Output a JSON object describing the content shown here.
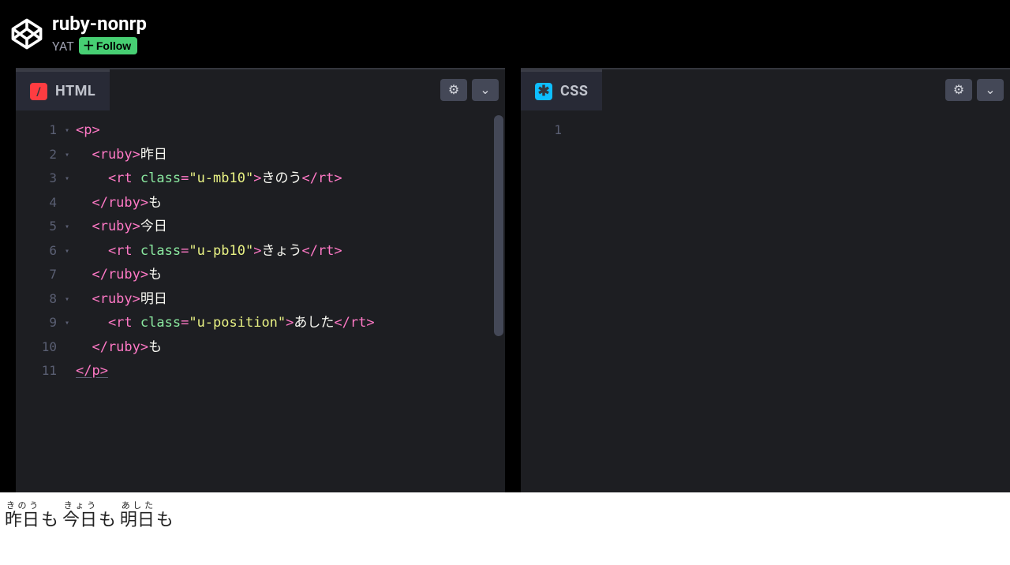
{
  "header": {
    "title": "ruby-nonrp",
    "author": "YAT",
    "follow_label": "Follow"
  },
  "editors": {
    "html": {
      "label": "HTML",
      "line_numbers": [
        "1",
        "2",
        "3",
        "4",
        "5",
        "6",
        "7",
        "8",
        "9",
        "10",
        "11"
      ],
      "fold_lines": [
        1,
        2,
        3,
        5,
        6,
        8,
        9
      ],
      "code": {
        "l1": {
          "a": "<p>"
        },
        "l2": {
          "a": "  <ruby>",
          "b": "昨日"
        },
        "l3": {
          "a": "    <rt ",
          "attr": "class",
          "eq": "=",
          "str": "\"u-mb10\"",
          "c": ">",
          "t": "きのう",
          "d": "</rt>"
        },
        "l4": {
          "a": "  </ruby>",
          "b": "も"
        },
        "l5": {
          "a": "  <ruby>",
          "b": "今日"
        },
        "l6": {
          "a": "    <rt ",
          "attr": "class",
          "eq": "=",
          "str": "\"u-pb10\"",
          "c": ">",
          "t": "きょう",
          "d": "</rt>"
        },
        "l7": {
          "a": "  </ruby>",
          "b": "も"
        },
        "l8": {
          "a": "  <ruby>",
          "b": "明日"
        },
        "l9": {
          "a": "    <rt ",
          "attr": "class",
          "eq": "=",
          "str": "\"u-position\"",
          "c": ">",
          "t": "あした",
          "d": "</rt>"
        },
        "l10": {
          "a": "  </ruby>",
          "b": "も"
        },
        "l11": {
          "a": "</p>"
        }
      }
    },
    "css": {
      "label": "CSS",
      "line_numbers": [
        "1"
      ]
    }
  },
  "preview": {
    "items": [
      {
        "base": "昨日",
        "rt": "きのう",
        "suffix": "も"
      },
      {
        "base": "今日",
        "rt": "きょう",
        "suffix": "も"
      },
      {
        "base": "明日",
        "rt": "あした",
        "suffix": "も"
      }
    ]
  }
}
